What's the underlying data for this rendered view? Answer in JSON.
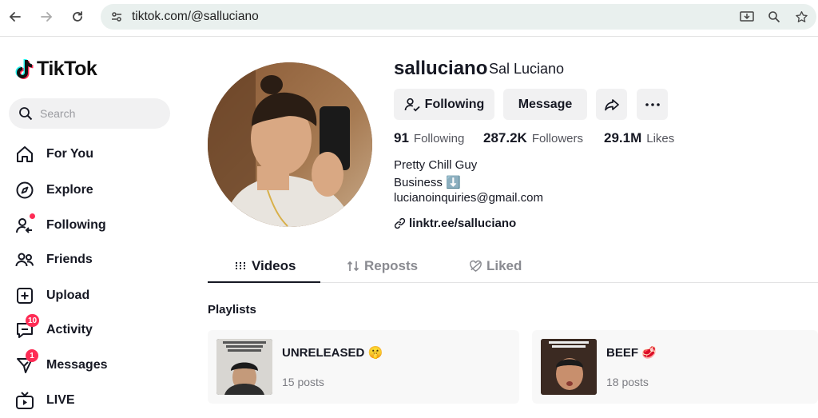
{
  "browser": {
    "url": "tiktok.com/@salluciano"
  },
  "sidebar": {
    "logo": "TikTok",
    "search_placeholder": "Search",
    "items": [
      {
        "label": "For You",
        "icon": "home-icon"
      },
      {
        "label": "Explore",
        "icon": "compass-icon"
      },
      {
        "label": "Following",
        "icon": "following-icon"
      },
      {
        "label": "Friends",
        "icon": "friends-icon"
      },
      {
        "label": "Upload",
        "icon": "upload-icon"
      },
      {
        "label": "Activity",
        "icon": "activity-icon",
        "badge": "10"
      },
      {
        "label": "Messages",
        "icon": "messages-icon",
        "badge": "1"
      },
      {
        "label": "LIVE",
        "icon": "live-icon"
      }
    ]
  },
  "profile": {
    "username": "salluciano",
    "nickname": "Sal Luciano",
    "buttons": {
      "following": "Following",
      "message": "Message"
    },
    "stats": {
      "following_count": "91",
      "following_label": "Following",
      "followers_count": "287.2K",
      "followers_label": "Followers",
      "likes_count": "29.1M",
      "likes_label": "Likes"
    },
    "bio": [
      "Pretty Chill Guy",
      "Business ⬇️",
      "lucianoinquiries@gmail.com"
    ],
    "link": "linktr.ee/salluciano"
  },
  "tabs": [
    {
      "label": "Videos",
      "active": true
    },
    {
      "label": "Reposts",
      "active": false
    },
    {
      "label": "Liked",
      "active": false
    }
  ],
  "playlists": {
    "title": "Playlists",
    "items": [
      {
        "title": "UNRELEASED 🤫",
        "count": "15 posts"
      },
      {
        "title": "BEEF 🥩",
        "count": "18 posts"
      }
    ]
  },
  "colors": {
    "accent": "#fe2c55",
    "text": "#161823",
    "button_bg": "#f1f1f2"
  }
}
